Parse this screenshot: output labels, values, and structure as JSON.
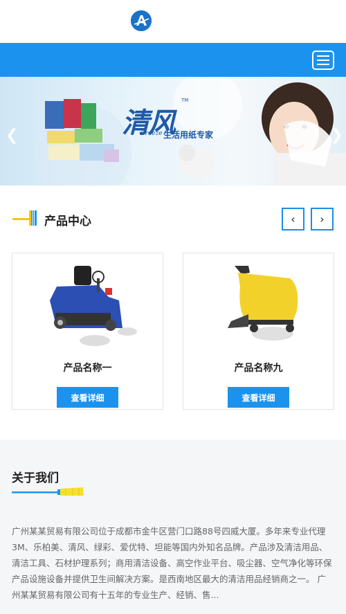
{
  "banner": {
    "brand": "清风",
    "tm": "TM",
    "breeze": "Breeze",
    "slogan": "生活用纸专家"
  },
  "products_section": {
    "title": "产品中心",
    "prev_label": "‹",
    "next_label": "›",
    "items": [
      {
        "name": "产品名称一",
        "button": "查看详细"
      },
      {
        "name": "产品名称九",
        "button": "查看详细"
      }
    ]
  },
  "about": {
    "title": "关于我们",
    "text": "广州某某贸易有限公司位于成都市金牛区营门口路88号四威大厦。多年来专业代理3M、乐柏美、清风、绿彩、爱优特、坦能等国内外知名品牌。产品涉及清洁用品、清洁工具、石材护理系列；商用清洁设备、高空作业平台、吸尘器、空气净化等环保产品设施设备并提供卫生间解决方案。是西南地区最大的清洁用品经销商之一。 广州某某贸易有限公司有十五年的专业生产、经销、售..."
  },
  "colors": {
    "accent": "#1b93ee",
    "logo": "#1a73c9",
    "about_bg": "#f5f6f8"
  }
}
